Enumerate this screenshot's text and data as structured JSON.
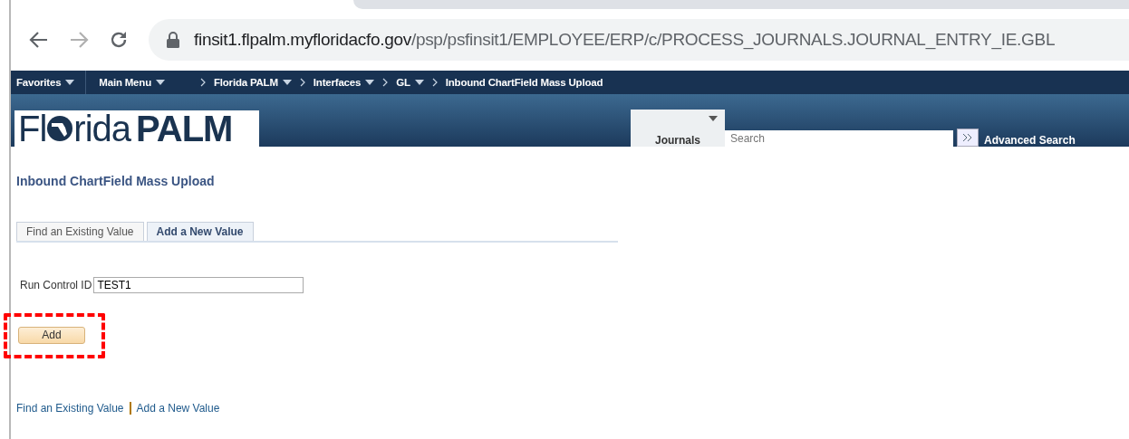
{
  "browser": {
    "url_host": "finsit1.flpalm.myfloridacfo.gov",
    "url_path": "/psp/psfinsit1/EMPLOYEE/ERP/c/PROCESS_JOURNALS.JOURNAL_ENTRY_IE.GBL"
  },
  "nav": {
    "menus": [
      {
        "label": "Favorites",
        "dropdown": true
      },
      {
        "label": "Main Menu",
        "dropdown": true
      }
    ],
    "breadcrumbs": [
      {
        "label": "Florida PALM",
        "dropdown": true
      },
      {
        "label": "Interfaces",
        "dropdown": true
      },
      {
        "label": "GL",
        "dropdown": true
      },
      {
        "label": "Inbound ChartField Mass Upload",
        "dropdown": false
      }
    ]
  },
  "header": {
    "logo": {
      "part_1": "Fl",
      "part_2": "rida",
      "bold": "PALM"
    },
    "search_category": "Journals",
    "search": {
      "placeholder": "Search"
    },
    "advanced_search": "Advanced Search"
  },
  "page": {
    "title": "Inbound ChartField Mass Upload",
    "tabs": [
      {
        "label": "Find an Existing Value",
        "selected": false
      },
      {
        "label": "Add a New Value",
        "selected": true
      }
    ],
    "field": {
      "label": "Run Control ID",
      "value": "TEST1"
    },
    "button": {
      "label": "Add",
      "highlighted": true
    },
    "links": [
      "Find an Existing Value",
      "Add a New Value"
    ]
  }
}
